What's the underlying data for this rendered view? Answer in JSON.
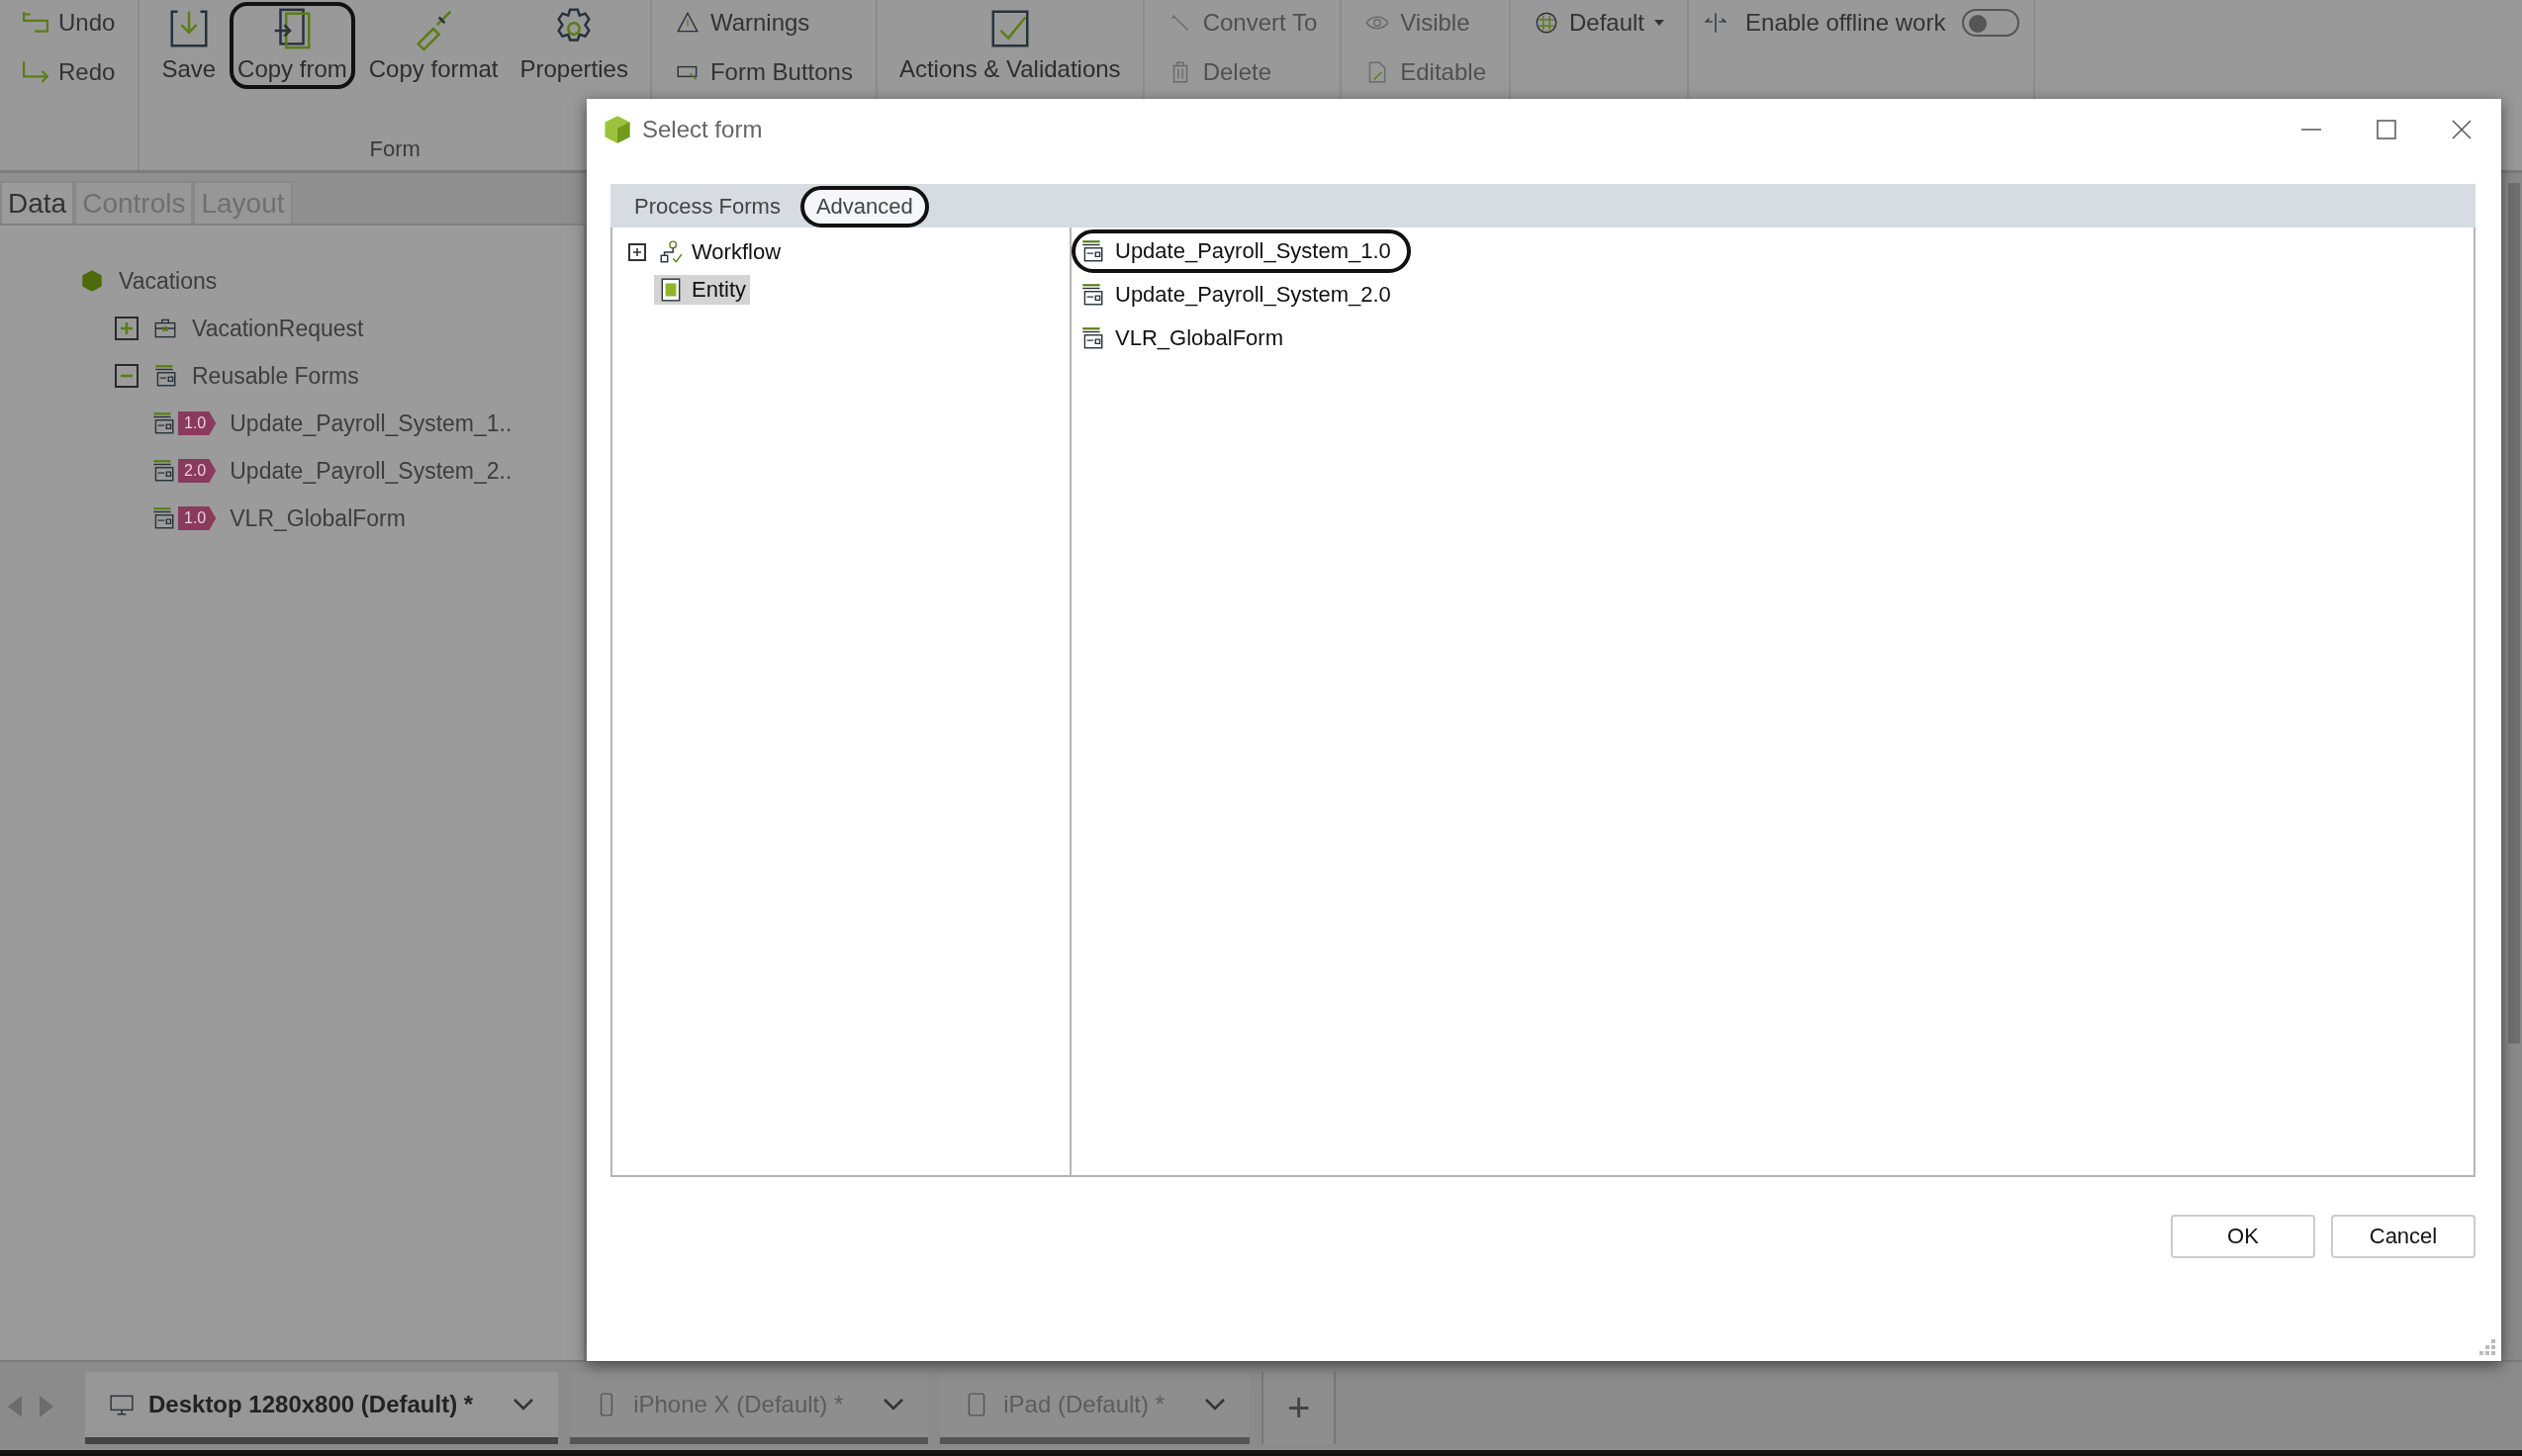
{
  "toolbar": {
    "groups": [
      {
        "kind": "small",
        "items": [
          {
            "label": "Undo",
            "annotated": false
          },
          {
            "label": "Redo",
            "annotated": false
          }
        ]
      },
      {
        "kind": "large",
        "caption": "Form",
        "items": [
          {
            "label": "Save",
            "annotated": false
          },
          {
            "label": "Copy from",
            "annotated": true
          },
          {
            "label": "Copy format",
            "annotated": false
          },
          {
            "label": "Properties",
            "annotated": false
          }
        ]
      },
      {
        "kind": "small",
        "items": [
          {
            "label": "Warnings",
            "annotated": false
          },
          {
            "label": "Form Buttons",
            "annotated": false
          }
        ]
      },
      {
        "kind": "large",
        "items": [
          {
            "label": "Actions & Validations",
            "annotated": false
          }
        ]
      },
      {
        "kind": "small",
        "items": [
          {
            "label": "Convert To",
            "annotated": false
          },
          {
            "label": "Delete",
            "annotated": false
          }
        ]
      },
      {
        "kind": "small",
        "items": [
          {
            "label": "Visible",
            "annotated": false
          },
          {
            "label": "Editable",
            "annotated": false
          }
        ]
      },
      {
        "kind": "dropdown",
        "items": [
          {
            "label": "Default",
            "annotated": false
          }
        ]
      },
      {
        "kind": "toggle",
        "items": [
          {
            "label": "Enable offline work",
            "annotated": false,
            "on": false
          }
        ]
      }
    ]
  },
  "left_panel": {
    "tabs": [
      {
        "label": "Data",
        "selected": true
      },
      {
        "label": "Controls",
        "selected": false
      },
      {
        "label": "Layout",
        "selected": false
      }
    ],
    "tree": [
      {
        "label": "Vacations",
        "kind": "app",
        "children": [
          {
            "label": "VacationRequest",
            "kind": "process",
            "expanded": false
          },
          {
            "label": "Reusable Forms",
            "kind": "folder",
            "expanded": true,
            "children": [
              {
                "label": "Update_Payroll_System_1..",
                "kind": "form",
                "badge": "1.0"
              },
              {
                "label": "Update_Payroll_System_2..",
                "kind": "form",
                "badge": "2.0"
              },
              {
                "label": "VLR_GlobalForm",
                "kind": "form",
                "badge": "1.0"
              }
            ]
          }
        ]
      }
    ]
  },
  "dialog": {
    "title": "Select form",
    "tabs": [
      {
        "label": "Process Forms",
        "selected": false,
        "annotated": false
      },
      {
        "label": "Advanced",
        "selected": true,
        "annotated": true
      }
    ],
    "tree": [
      {
        "label": "Workflow",
        "expanded": false,
        "selected": false
      },
      {
        "label": "Entity",
        "selected": true
      }
    ],
    "forms": [
      {
        "label": "Update_Payroll_System_1.0",
        "annotated": true
      },
      {
        "label": "Update_Payroll_System_2.0",
        "annotated": false
      },
      {
        "label": "VLR_GlobalForm",
        "annotated": false
      }
    ],
    "buttons": [
      "OK",
      "Cancel"
    ]
  },
  "device_tabs": [
    {
      "label": "Desktop 1280x800 (Default) *",
      "selected": true
    },
    {
      "label": "iPhone X (Default) *",
      "selected": false
    },
    {
      "label": "iPad (Default) *",
      "selected": false
    }
  ],
  "add_tab": "+"
}
